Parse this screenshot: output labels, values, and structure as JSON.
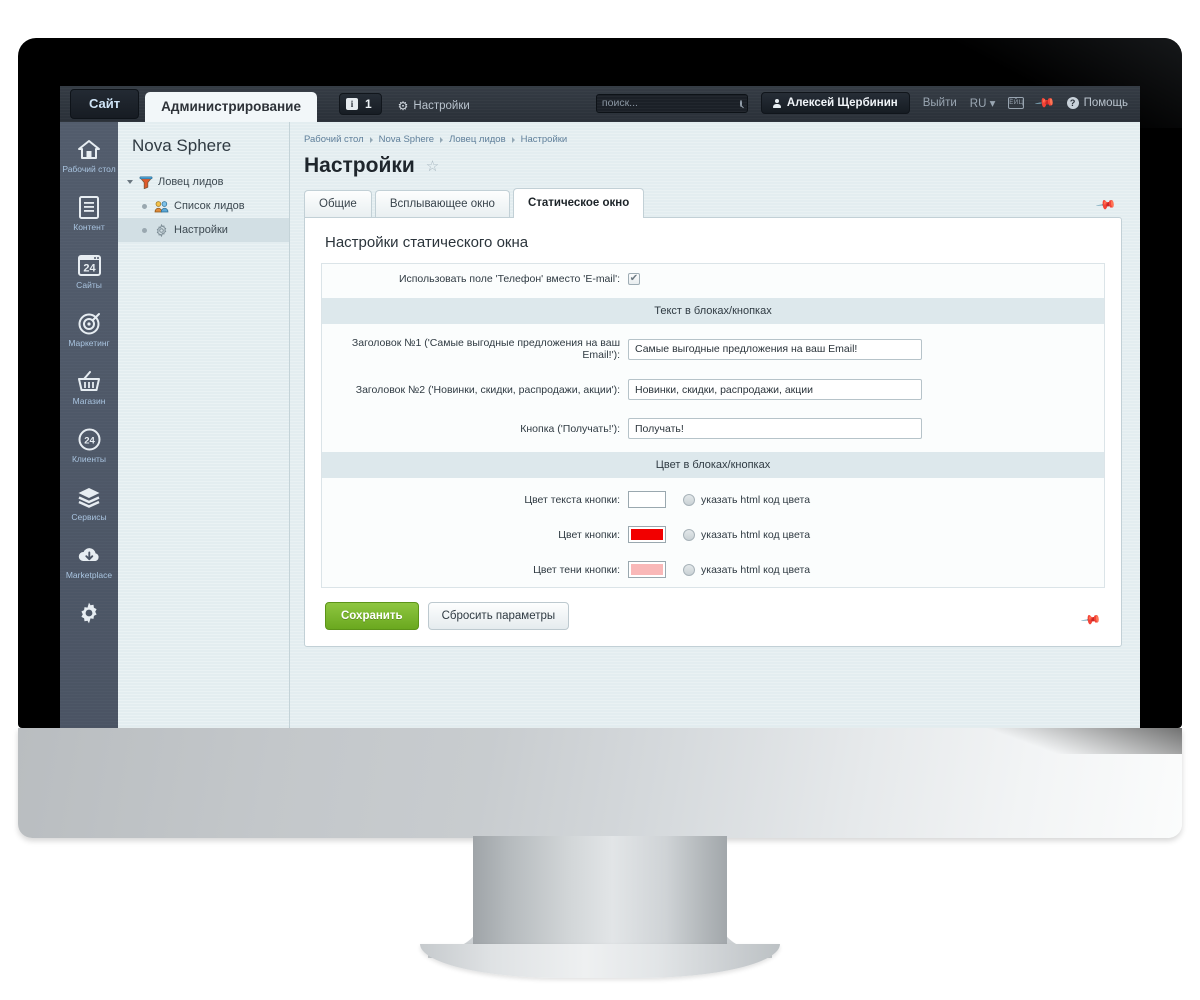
{
  "topbar": {
    "site_tab": "Сайт",
    "admin_tab": "Администрирование",
    "notify_icon": "info-icon",
    "notify_count": "1",
    "settings_label": "Настройки",
    "search_placeholder": "поиск...",
    "search_value": "",
    "search_icon": "search-icon",
    "user_name": "Алексей Щербинин",
    "user_icon": "person-icon",
    "logout_label": "Выйти",
    "lang_label": "RU",
    "keyboard_icon": "keyboard-icon",
    "keyboard_text": "ЁЙЦ",
    "pin_icon": "pin-icon",
    "help_label": "Помощь",
    "help_icon": "question-icon"
  },
  "rail": {
    "items": [
      {
        "label": "Рабочий стол",
        "icon": "home-icon"
      },
      {
        "label": "Контент",
        "icon": "document-icon"
      },
      {
        "label": "Сайты",
        "icon": "calendar-24-icon"
      },
      {
        "label": "Маркетинг",
        "icon": "target-icon"
      },
      {
        "label": "Магазин",
        "icon": "basket-icon"
      },
      {
        "label": "Клиенты",
        "icon": "clients-24-icon"
      },
      {
        "label": "Сервисы",
        "icon": "layers-icon"
      },
      {
        "label": "Marketplace",
        "icon": "cloud-download-icon"
      },
      {
        "label": "",
        "icon": "gear-icon"
      }
    ]
  },
  "sidebar": {
    "module_title": "Nova Sphere",
    "tree": [
      {
        "label": "Ловец лидов",
        "icon": "funnel-icon",
        "level": 0,
        "expanded": true,
        "selected": false
      },
      {
        "label": "Список лидов",
        "icon": "people-icon",
        "level": 1,
        "expanded": false,
        "selected": false
      },
      {
        "label": "Настройки",
        "icon": "gear-small-icon",
        "level": 1,
        "expanded": false,
        "selected": true
      }
    ]
  },
  "breadcrumb": {
    "items": [
      "Рабочий стол",
      "Nova Sphere",
      "Ловец лидов",
      "Настройки"
    ]
  },
  "page": {
    "title": "Настройки",
    "favorite_icon": "star-icon",
    "pin_icon": "pin-icon"
  },
  "tabs": [
    {
      "label": "Общие",
      "active": false
    },
    {
      "label": "Всплывающее окно",
      "active": false
    },
    {
      "label": "Статическое окно",
      "active": true
    }
  ],
  "panel": {
    "title": "Настройки статического окна",
    "phone_instead_email": {
      "label": "Использовать поле 'Телефон' вместо 'E-mail':",
      "checked": true
    },
    "text_section": {
      "heading": "Текст в блоках/кнопках",
      "fields": [
        {
          "label": "Заголовок №1 ('Самые выгодные предложения на ваш Email!'):",
          "value": "Самые выгодные предложения на ваш Email!"
        },
        {
          "label": "Заголовок №2 ('Новинки, скидки, распродажи, акции'):",
          "value": "Новинки, скидки, распродажи, акции"
        },
        {
          "label": "Кнопка ('Получать!'):",
          "value": "Получать!"
        }
      ]
    },
    "color_section": {
      "heading": "Цвет в блоках/кнопках",
      "html_code_label": "указать html код цвета",
      "rows": [
        {
          "label": "Цвет текста кнопки:",
          "color": "#ffffff",
          "html_checked": false
        },
        {
          "label": "Цвет кнопки:",
          "color": "#f20000",
          "html_checked": false
        },
        {
          "label": "Цвет тени кнопки:",
          "color": "#f9b8b8",
          "html_checked": false
        }
      ]
    }
  },
  "actions": {
    "save_label": "Сохранить",
    "reset_label": "Сбросить параметры",
    "pin_icon": "pin-icon"
  },
  "theme": {
    "accent_green": "#6aa81f",
    "topbar_bg": "#2b3139",
    "rail_bg": "#4c5666",
    "page_bg": "#e3edf0",
    "section_head_bg": "#dde8ec"
  }
}
